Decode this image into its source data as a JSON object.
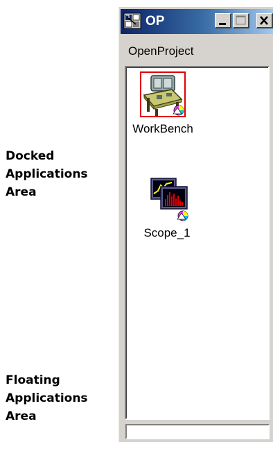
{
  "annotations": {
    "docked": [
      "Docked",
      "Applications",
      "Area"
    ],
    "floating": [
      "Floating",
      "Applications",
      "Area"
    ]
  },
  "window": {
    "title": "OP",
    "icon": "project-icon",
    "buttons": {
      "minimize": "minimize-icon",
      "maximize": "maximize-icon",
      "close": "close-icon"
    },
    "colors": {
      "titlebar_start": "#0a246a",
      "titlebar_end": "#a6caf0",
      "face": "#d6d3ce"
    }
  },
  "menu": {
    "items": [
      {
        "label": "OpenProject"
      }
    ]
  },
  "apps": [
    {
      "label": "WorkBench",
      "icon": "workbench-icon",
      "selected": true
    },
    {
      "label": "Scope_1",
      "icon": "scope-icon",
      "selected": false
    }
  ],
  "statusbar": {
    "text": ""
  }
}
